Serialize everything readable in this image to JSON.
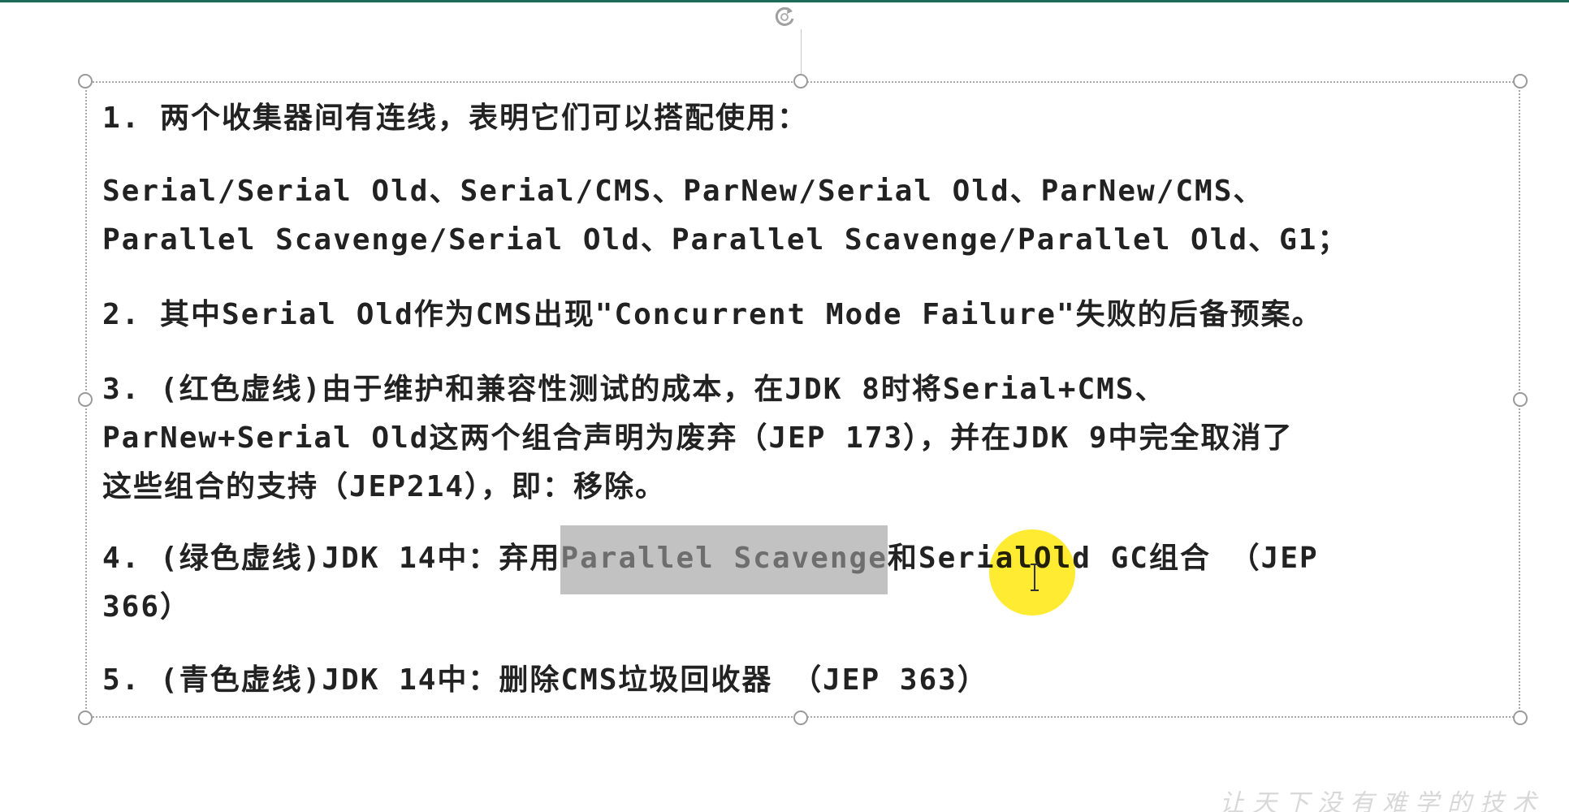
{
  "slide": {
    "points": [
      {
        "lines": [
          "1. 两个收集器间有连线，表明它们可以搭配使用："
        ]
      },
      {
        "lines": [
          "Serial/Serial Old、Serial/CMS、ParNew/Serial Old、ParNew/CMS、",
          "Parallel Scavenge/Serial Old、Parallel Scavenge/Parallel Old、G1；"
        ]
      },
      {
        "lines": [
          "2. 其中Serial Old作为CMS出现\"Concurrent Mode Failure\"失败的后备预案。"
        ]
      },
      {
        "lines": [
          "3. (红色虚线)由于维护和兼容性测试的成本，在JDK 8时将Serial+CMS、",
          "ParNew+Serial Old这两个组合声明为废弃（JEP 173），并在JDK 9中完全取消了",
          "这些组合的支持（JEP214），即：移除。"
        ]
      },
      {
        "line1_before": "4. (绿色虚线)JDK 14中：弃用",
        "line1_selected": "Parallel Scavenge",
        "line1_after": "和SerialOld GC组合 （JEP",
        "line2": "366）"
      },
      {
        "lines": [
          "5. (青色虚线)JDK 14中：删除CMS垃圾回收器 （JEP 363）"
        ]
      }
    ],
    "watermark": "让天下没有难学的技术"
  },
  "colors": {
    "top_bar": "#1f6b5a",
    "selection": "#c2c2c2",
    "cursor_highlight": "#ffe814"
  },
  "icons": {
    "rotate": "rotate-handle-icon",
    "cursor": "text-cursor-icon"
  }
}
